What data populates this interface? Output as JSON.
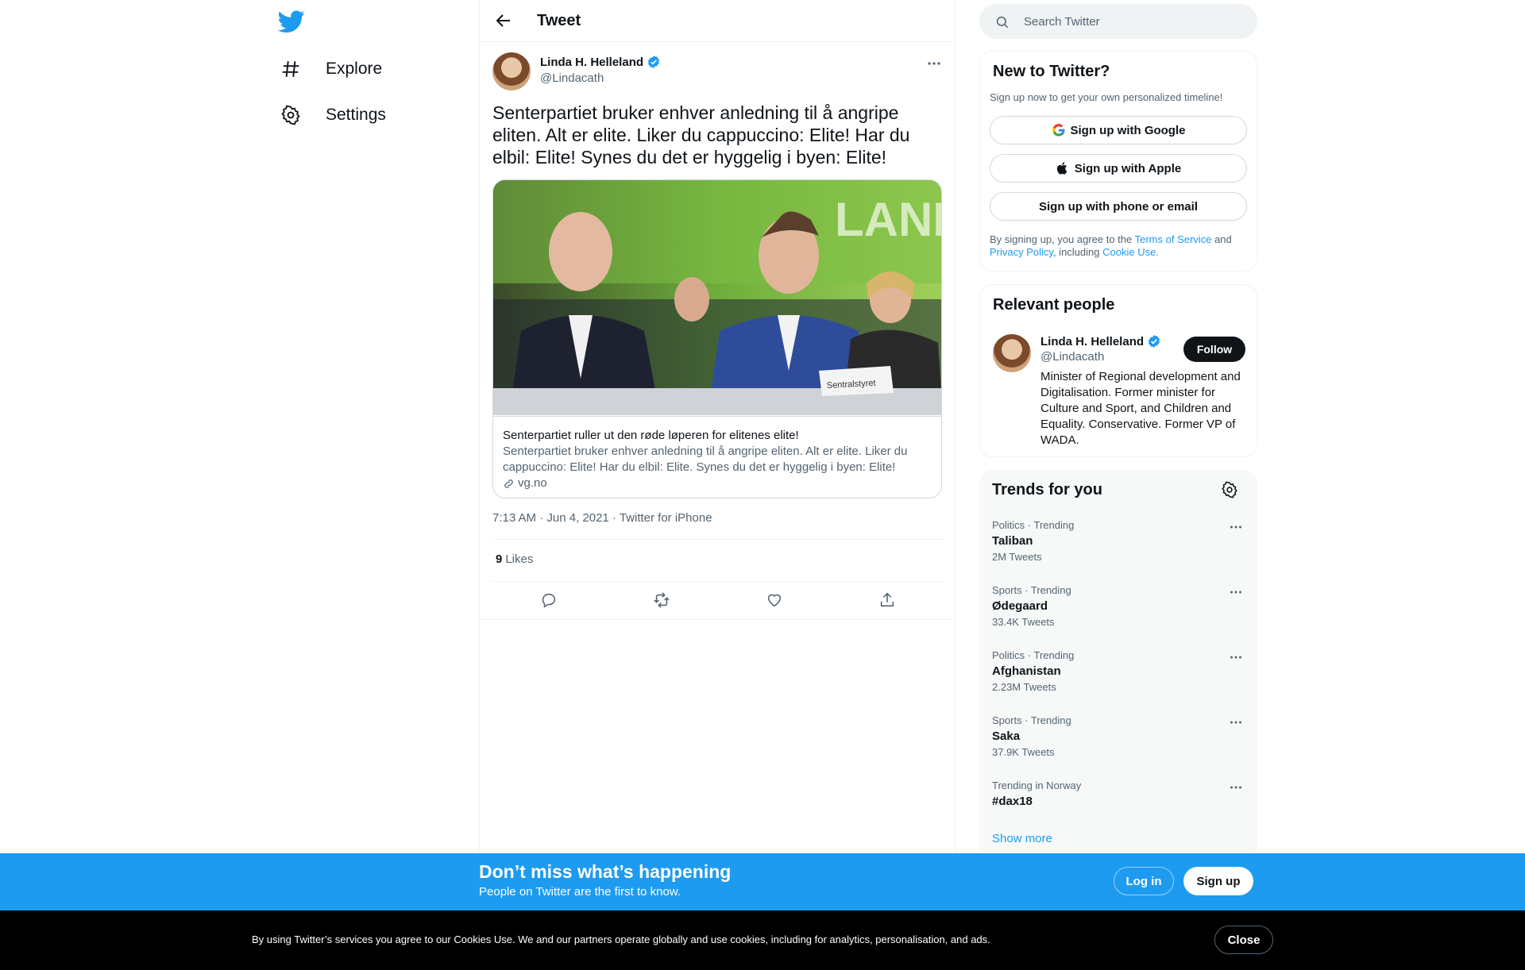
{
  "nav": {
    "logo_icon": "twitter-bird-icon",
    "items": [
      {
        "label": "Explore",
        "icon": "hashtag-icon"
      },
      {
        "label": "Settings",
        "icon": "gear-icon"
      }
    ]
  },
  "header": {
    "title": "Tweet"
  },
  "tweet": {
    "author_name": "Linda H. Helleland",
    "author_handle": "@Lindacath",
    "text": "Senterpartiet bruker enhver anledning til å angripe eliten. Alt er elite. Liker du cappuccino: Elite! Har du elbil: Elite! Synes du det er hyggelig i byen: Elite!",
    "card": {
      "title": "Senterpartiet ruller ut den røde løperen for elitenes elite!",
      "description": "Senterpartiet bruker enhver anledning til å angripe eliten. Alt er elite. Liker du cappuccino: Elite! Har du elbil: Elite. Synes du det er hyggelig i byen: Elite!",
      "domain": "vg.no",
      "image_sign_text": "Sentralstyret"
    },
    "meta": "7:13 AM · Jun 4, 2021 · Twitter for iPhone",
    "likes_count": "9",
    "likes_label": "Likes"
  },
  "search": {
    "placeholder": "Search Twitter"
  },
  "signup": {
    "title": "New to Twitter?",
    "subtitle": "Sign up now to get your own personalized timeline!",
    "google_label": "Sign up with Google",
    "apple_label": "Sign up with Apple",
    "email_label": "Sign up with phone or email",
    "legal_prefix": "By signing up, you agree to the",
    "terms_link": "Terms of Service",
    "legal_and": "and",
    "privacy_link": "Privacy Policy",
    "legal_including": ", including",
    "cookie_link": "Cookie Use."
  },
  "relevant": {
    "title": "Relevant people",
    "name": "Linda H. Helleland",
    "handle": "@Lindacath",
    "follow_label": "Follow",
    "bio": "Minister of Regional development and Digitalisation. Former minister for Culture and Sport, and Children and Equality. Conservative. Former VP of WADA."
  },
  "trends": {
    "title": "Trends for you",
    "items": [
      {
        "context": "Politics · Trending",
        "name": "Taliban",
        "count": "2M Tweets"
      },
      {
        "context": "Sports · Trending",
        "name": "Ødegaard",
        "count": "33.4K Tweets"
      },
      {
        "context": "Politics · Trending",
        "name": "Afghanistan",
        "count": "2.23M Tweets"
      },
      {
        "context": "Sports · Trending",
        "name": "Saka",
        "count": "37.9K Tweets"
      },
      {
        "context": "Trending in Norway",
        "name": "#dax18",
        "count": ""
      }
    ],
    "show_more": "Show more"
  },
  "banner": {
    "headline": "Don’t miss what’s happening",
    "subline": "People on Twitter are the first to know.",
    "login_label": "Log in",
    "signup_label": "Sign up"
  },
  "cookie": {
    "text": "By using Twitter’s services you agree to our Cookies Use. We and our partners operate globally and use cookies, including for analytics, personalisation, and ads.",
    "close_label": "Close"
  },
  "colors": {
    "accent": "#1d9bf0",
    "text": "#0f1419",
    "muted": "#536471",
    "border": "#eff3f4"
  }
}
